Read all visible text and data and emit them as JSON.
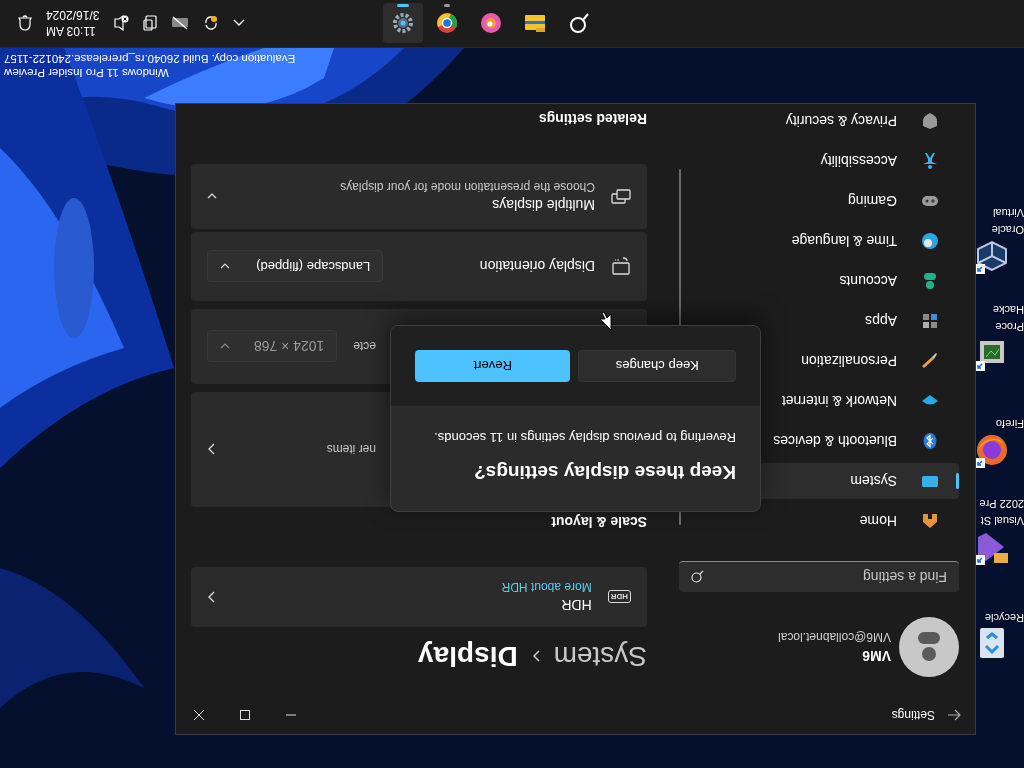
{
  "desktop_icons": [
    {
      "label_lines": [
        "Recycle"
      ]
    },
    {
      "label_lines": [
        "Visual St",
        "2022 Pre"
      ]
    },
    {
      "label_lines": [
        "Firefo"
      ]
    },
    {
      "label_lines": [
        "Proce",
        "Hacke"
      ]
    },
    {
      "label_lines": [
        "Oracle",
        "Virtual"
      ]
    }
  ],
  "settings_window": {
    "title": "Settings",
    "profile": {
      "name": "VM6",
      "email": "VM6@collabnet.local"
    },
    "search": {
      "placeholder": "Find a setting"
    },
    "nav": [
      {
        "label": "Home",
        "selected": false
      },
      {
        "label": "System",
        "selected": true
      },
      {
        "label": "Bluetooth & devices",
        "selected": false
      },
      {
        "label": "Network & internet",
        "selected": false
      },
      {
        "label": "Personalization",
        "selected": false
      },
      {
        "label": "Apps",
        "selected": false
      },
      {
        "label": "Accounts",
        "selected": false
      },
      {
        "label": "Time & language",
        "selected": false
      },
      {
        "label": "Gaming",
        "selected": false
      },
      {
        "label": "Accessibility",
        "selected": false
      },
      {
        "label": "Privacy & security",
        "selected": false
      }
    ],
    "breadcrumb": [
      "System",
      "Display"
    ],
    "rows": [
      {
        "kind": "link",
        "badge": "HDR",
        "title": "HDR",
        "link": "More about HDR"
      },
      {
        "kind": "header",
        "title": "Scale & layout"
      },
      {
        "kind": "partial",
        "text": "ner items"
      },
      {
        "kind": "partialdropdown",
        "text": "ecte",
        "value": "1024 × 768"
      },
      {
        "kind": "dropdown",
        "title": "Display orientation",
        "value": "Landscape (flipped)"
      },
      {
        "kind": "expander",
        "title": "Multiple displays",
        "description": "Choose the presentation mode for your displays"
      },
      {
        "kind": "header",
        "title": "Related settings"
      }
    ]
  },
  "dialog": {
    "title": "Keep these display settings?",
    "message": "Reverting to previous display settings in 11 seconds.",
    "buttons": [
      {
        "label": "Keep changes",
        "primary": false
      },
      {
        "label": "Revert",
        "primary": true
      }
    ]
  },
  "system_watermark": [
    "Windows 11 Pro Insider Preview",
    "Evaluation copy. Build 26040.rs_prerelease.240122-1157"
  ],
  "taskbar": {
    "apps": [
      {
        "selected": false,
        "running": false
      },
      {
        "selected": false,
        "running": false
      },
      {
        "selected": false,
        "running": false
      },
      {
        "selected": false,
        "running": true
      },
      {
        "selected": true,
        "running": true
      }
    ],
    "clock": {
      "time": "11:03 AM",
      "date": "3/16/2024"
    }
  }
}
